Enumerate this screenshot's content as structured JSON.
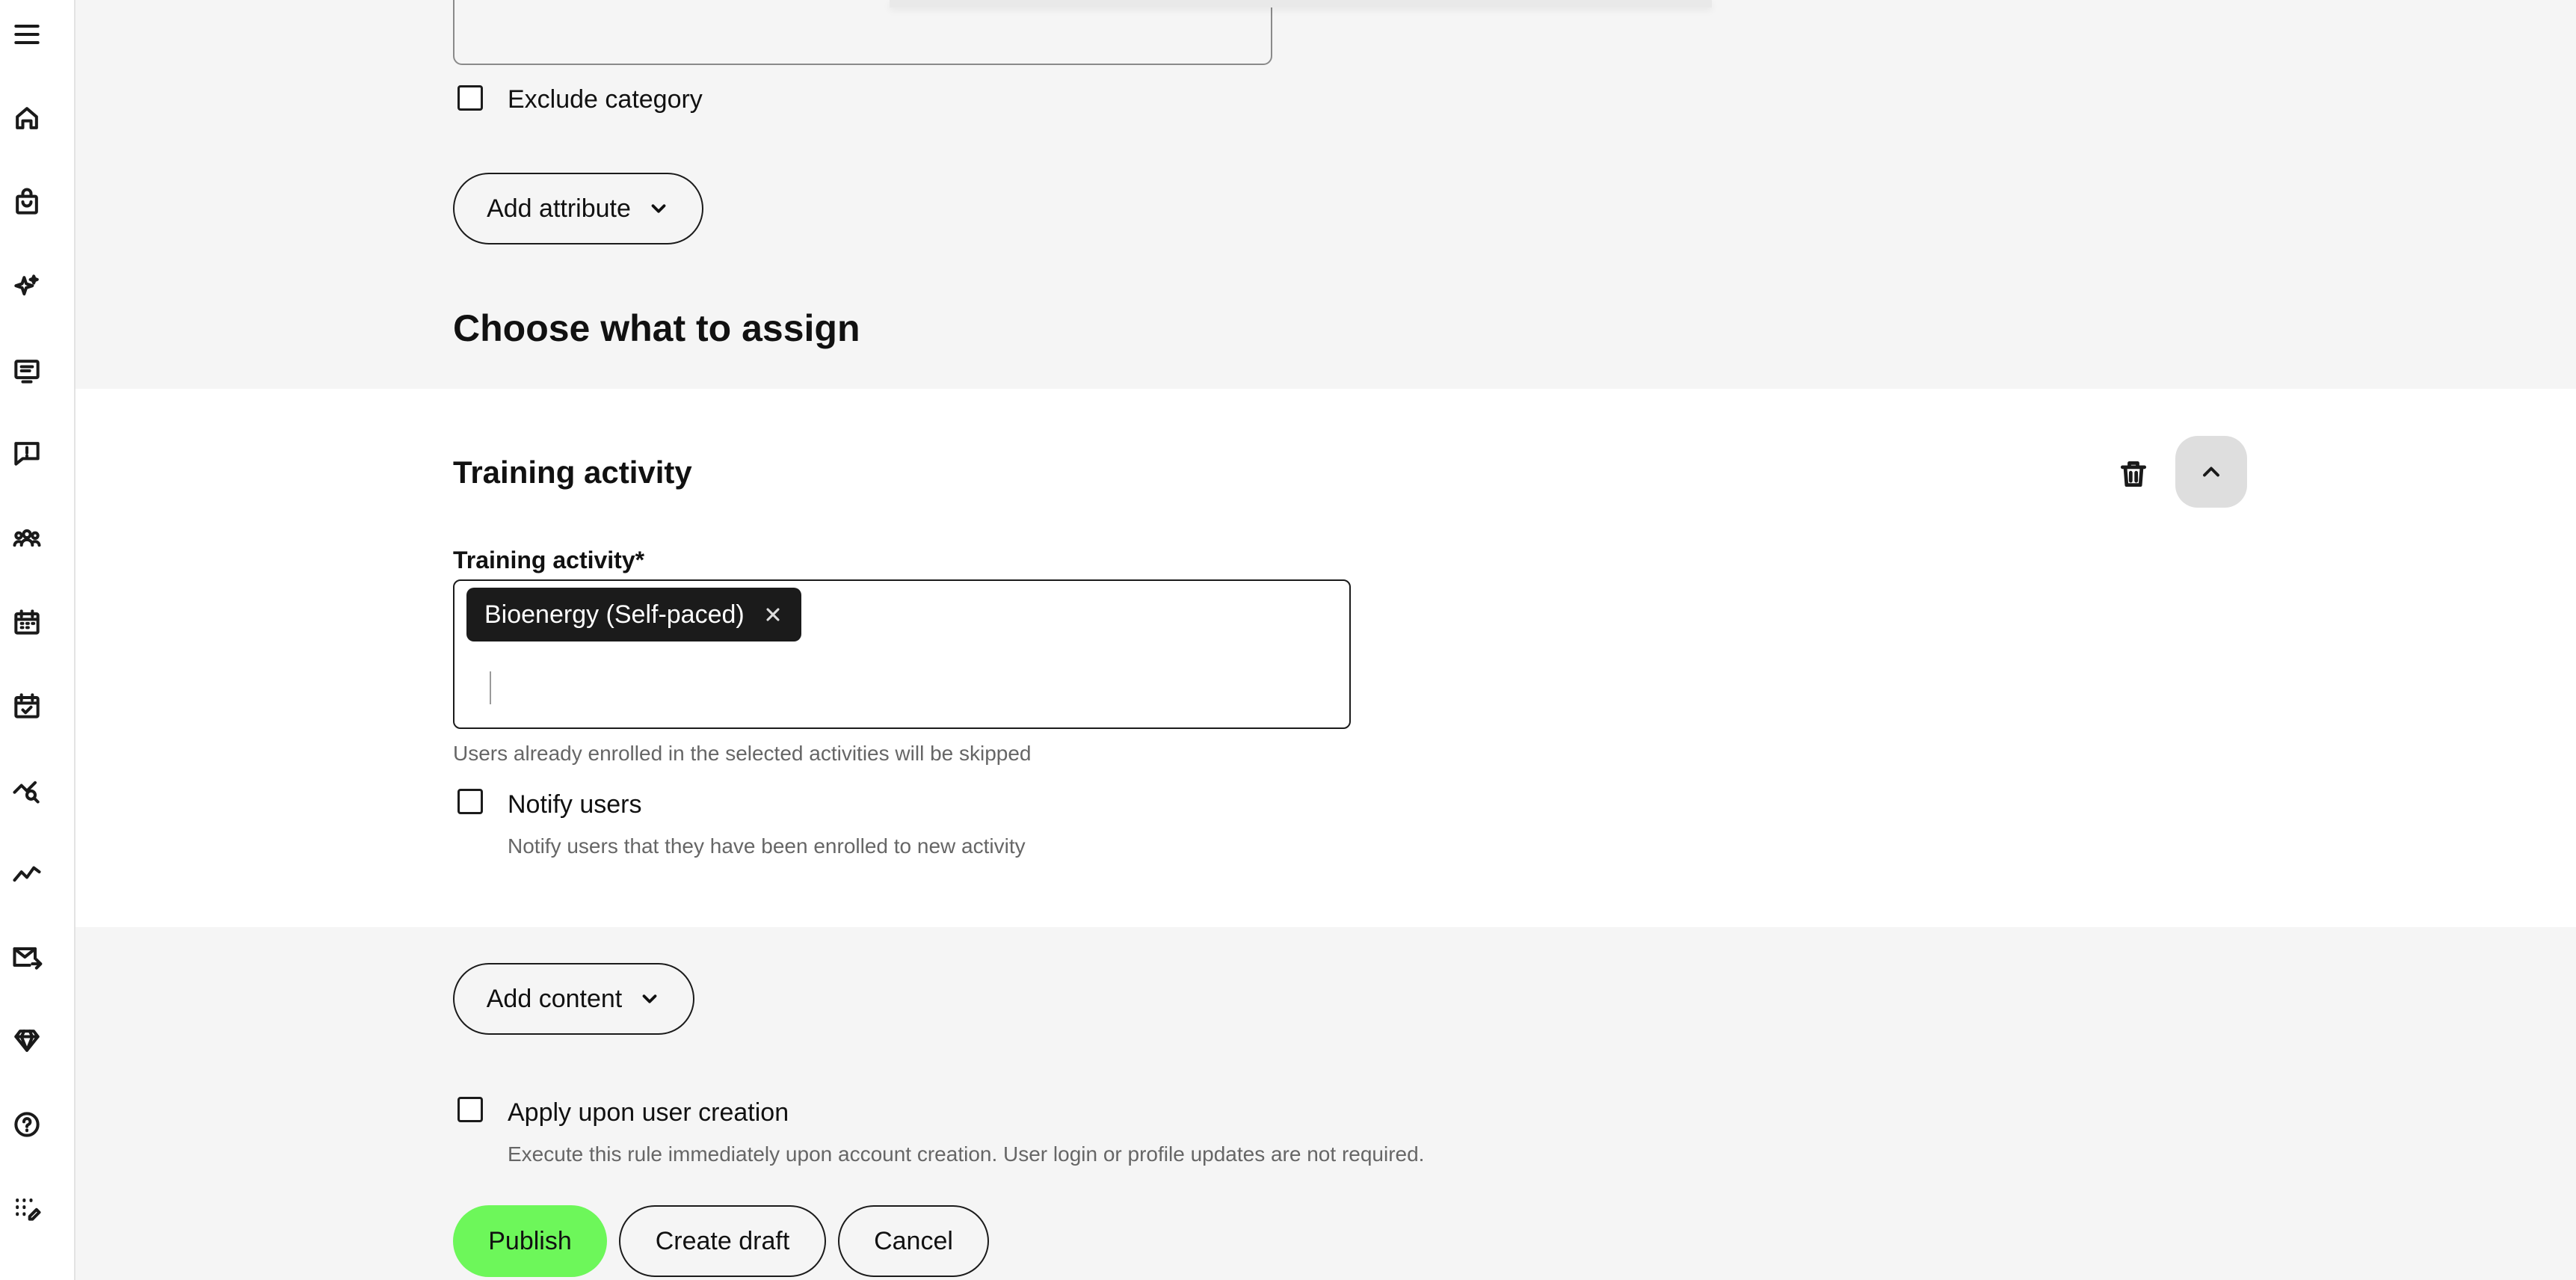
{
  "sidebar": {
    "items": [
      {
        "icon": "menu-icon",
        "name": "menu"
      },
      {
        "icon": "home-icon",
        "name": "home"
      },
      {
        "icon": "shopping-bag-icon",
        "name": "catalog"
      },
      {
        "icon": "sparkles-icon",
        "name": "ai"
      },
      {
        "icon": "course-icon",
        "name": "courses"
      },
      {
        "icon": "alert-message-icon",
        "name": "feedback"
      },
      {
        "icon": "users-icon",
        "name": "users"
      },
      {
        "icon": "calendar-icon",
        "name": "calendar"
      },
      {
        "icon": "calendar-check-icon",
        "name": "sessions"
      },
      {
        "icon": "analytics-search-icon",
        "name": "analytics"
      },
      {
        "icon": "trend-icon",
        "name": "reports"
      },
      {
        "icon": "mail-send-icon",
        "name": "notifications"
      },
      {
        "icon": "gem-icon",
        "name": "premium"
      },
      {
        "icon": "help-icon",
        "name": "help"
      },
      {
        "icon": "apps-edit-icon",
        "name": "customize"
      }
    ]
  },
  "filters": {
    "exclude_category_label": "Exclude category",
    "add_attribute_label": "Add attribute"
  },
  "assign": {
    "heading": "Choose what to assign",
    "card_title": "Training activity",
    "field_label": "Training activity",
    "required_mark": "*",
    "selected_chip": "Bioenergy (Self-paced)",
    "helper_text": "Users already enrolled in the selected activities will be skipped",
    "notify_label": "Notify users",
    "notify_help": "Notify users that they have been enrolled to new activity"
  },
  "content": {
    "add_content_label": "Add content"
  },
  "creation": {
    "apply_label": "Apply upon user creation",
    "apply_help": "Execute this rule immediately upon account creation. User login or profile updates are not required."
  },
  "actions": {
    "publish": "Publish",
    "create_draft": "Create draft",
    "cancel": "Cancel"
  },
  "colors": {
    "primary": "#6df75a",
    "chip_bg": "#1b1b1b",
    "page_bg": "#f5f5f5"
  }
}
